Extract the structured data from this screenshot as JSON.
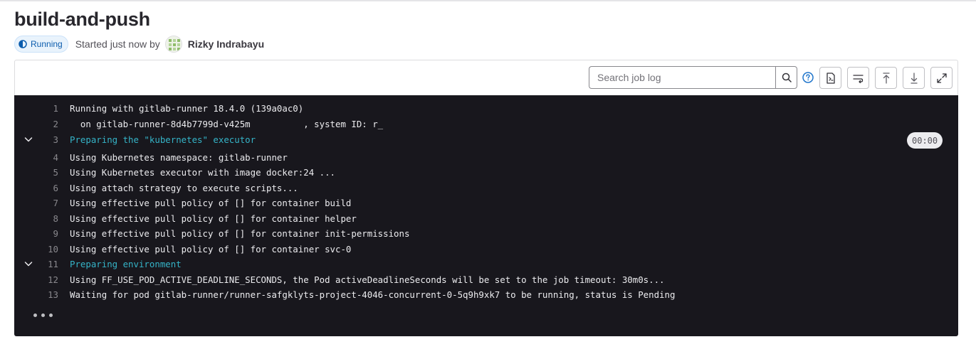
{
  "job": {
    "title": "build-and-push",
    "status": "Running",
    "started_text": "Started just now by",
    "user": "Rizky Indrabayu"
  },
  "toolbar": {
    "search_placeholder": "Search job log",
    "icons": [
      "search-icon",
      "help-icon",
      "raw-log-icon",
      "wrap-lines-icon",
      "scroll-top-icon",
      "scroll-bottom-icon",
      "fullscreen-icon"
    ]
  },
  "log": {
    "section_duration": "00:00",
    "lines": [
      {
        "n": "1",
        "text": "Running with gitlab-runner 18.4.0 (139a0ac0)"
      },
      {
        "n": "2",
        "text": "  on gitlab-runner-8d4b7799d-v425m          , system ID: r_"
      },
      {
        "n": "3",
        "text": "Preparing the \"kubernetes\" executor"
      },
      {
        "n": "4",
        "text": "Using Kubernetes namespace: gitlab-runner"
      },
      {
        "n": "5",
        "text": "Using Kubernetes executor with image docker:24 ..."
      },
      {
        "n": "6",
        "text": "Using attach strategy to execute scripts..."
      },
      {
        "n": "7",
        "text": "Using effective pull policy of [] for container build"
      },
      {
        "n": "8",
        "text": "Using effective pull policy of [] for container helper"
      },
      {
        "n": "9",
        "text": "Using effective pull policy of [] for container init-permissions"
      },
      {
        "n": "10",
        "text": "Using effective pull policy of [] for container svc-0"
      },
      {
        "n": "11",
        "text": "Preparing environment"
      },
      {
        "n": "12",
        "text": "Using FF_USE_POD_ACTIVE_DEADLINE_SECONDS, the Pod activeDeadlineSeconds will be set to the job timeout: 30m0s..."
      },
      {
        "n": "13",
        "text": "Waiting for pod gitlab-runner/runner-safgklyts-project-4046-concurrent-0-5q9h9xk7 to be running, status is Pending"
      }
    ]
  },
  "colors": {
    "log_background": "#18171d",
    "section_header": "#35b4c8",
    "status_running": "#0b5cad"
  }
}
